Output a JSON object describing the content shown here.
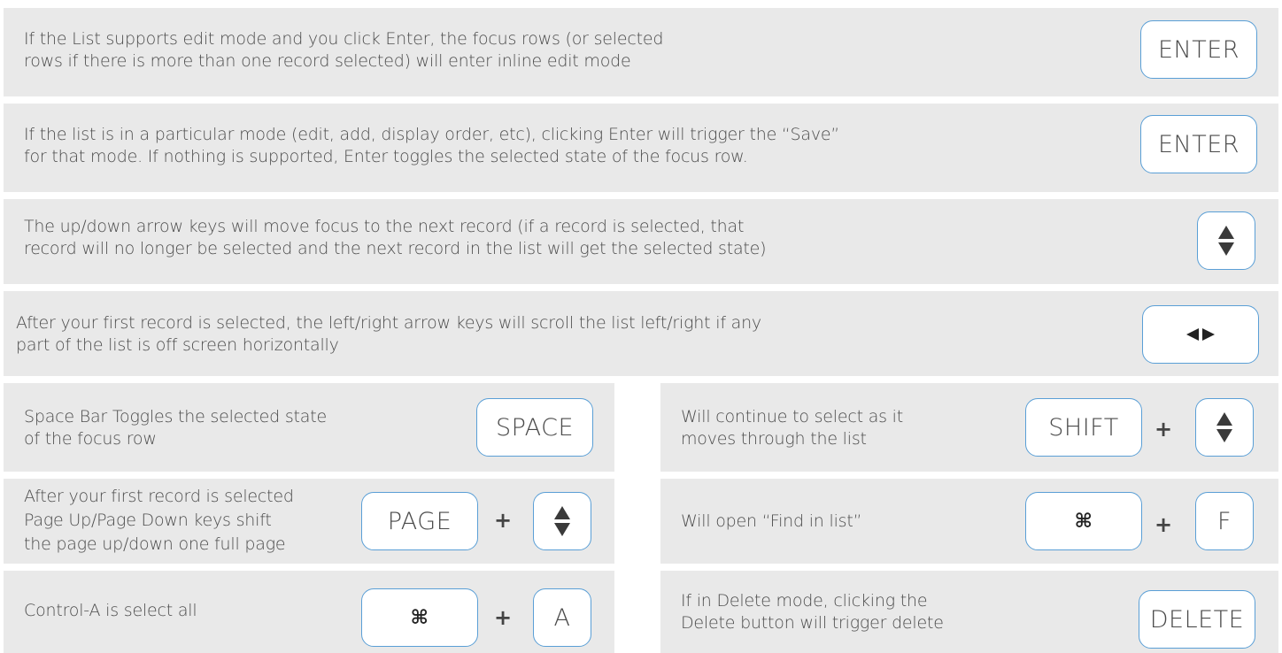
{
  "rows": [
    {
      "text_line1": "If the List supports edit mode and you click Enter, the focus rows (or selected",
      "text_line2": "rows if there is more than one record selected) will enter inline edit mode",
      "key": "ENTER"
    },
    {
      "text_line1": "If the list is in a particular mode (edit, add, display order, etc), clicking Enter will trigger the “Save”",
      "text_line2": "for that mode. If nothing is supported, Enter toggles the selected state of the focus row.",
      "key": "ENTER"
    },
    {
      "text_line1": "The up/down arrow keys will move focus to the next record (if a record is selected, that",
      "text_line2": "record will no longer be selected and the next record in the list will get the selected state)",
      "key_icon": "up-down-arrows-icon"
    },
    {
      "text_line1": "After your first record is selected, the left/right arrow keys will scroll the list left/right if any",
      "text_line2": "part of the list is off screen horizontally",
      "key_icon": "left-right-arrows-icon"
    }
  ],
  "grid": {
    "space": {
      "line1": "Space Bar Toggles the selected state",
      "line2": "of the focus row",
      "key": "SPACE"
    },
    "page": {
      "line1": "After your first record is selected",
      "line2": "Page Up/Page Down keys shift",
      "line3": "the page up/down one full page",
      "key": "PAGE",
      "plus": "+",
      "key2_icon": "up-down-arrows-icon"
    },
    "control_a": {
      "line1": "Control-A is select all",
      "key": "⌘",
      "plus": "+",
      "key2": "A"
    },
    "shift": {
      "line1": "Will continue to select as it",
      "line2": "moves through the list",
      "key": "SHIFT",
      "plus": "+",
      "key2_icon": "up-down-arrows-icon"
    },
    "find": {
      "line1": "Will open “Find in list”",
      "key": "⌘",
      "plus": "+",
      "key2": "F"
    },
    "delete": {
      "line1": "If in Delete mode, clicking the",
      "line2": "Delete button will trigger delete",
      "key": "DELETE"
    }
  },
  "colors": {
    "row_bg": "#e9e9e9",
    "key_border": "#5a9fd6"
  }
}
